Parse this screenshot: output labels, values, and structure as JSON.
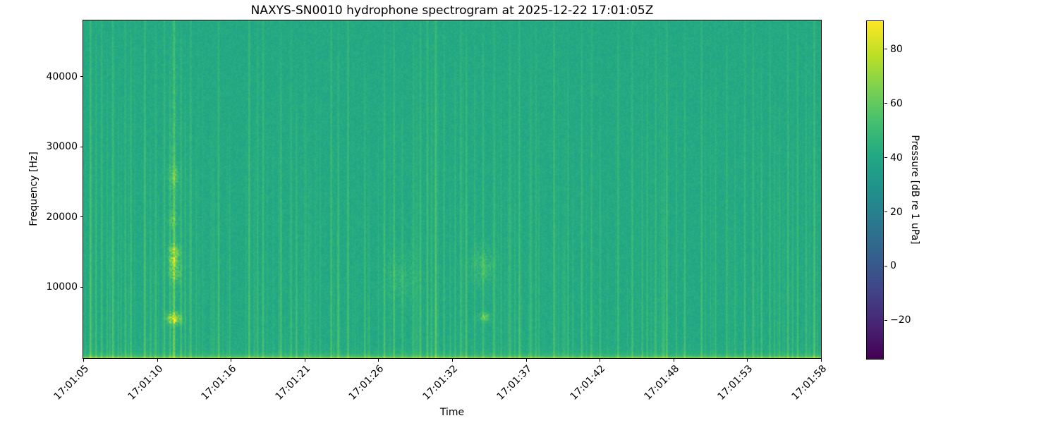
{
  "chart_data": {
    "type": "heatmap",
    "subtype": "spectrogram",
    "title": "NAXYS-SN0010 hydrophone spectrogram at 2025-12-22 17:01:05Z",
    "xlabel": "Time",
    "ylabel": "Frequency [Hz]",
    "x_tick_labels": [
      "17:01:05",
      "17:01:10",
      "17:01:16",
      "17:01:21",
      "17:01:26",
      "17:01:32",
      "17:01:37",
      "17:01:42",
      "17:01:48",
      "17:01:53",
      "17:01:58"
    ],
    "y_ticks_hz": [
      10000,
      20000,
      30000,
      40000
    ],
    "freq_range_hz": [
      0,
      48000
    ],
    "time_span_s": 53,
    "start_time": "17:01:05Z",
    "colormap": "viridis",
    "grid": false,
    "colorbar": {
      "label": "Pressure [dB re 1 uPa]",
      "vmin": -34,
      "vmax": 90.4,
      "ticks": [
        {
          "v": 80,
          "label": "80"
        },
        {
          "v": 60,
          "label": "60"
        },
        {
          "v": 40,
          "label": "40"
        },
        {
          "v": 20,
          "label": "20"
        },
        {
          "v": 0,
          "label": "0"
        },
        {
          "v": -20,
          "label": "−20"
        }
      ]
    },
    "background_db": 41,
    "noise_db": 2.6,
    "bottom_band": {
      "desc": "bright low-frequency noise band below ~1 kHz",
      "peak_boost_db": 26
    },
    "transients": [
      [
        0.5,
        0.85,
        1.0
      ],
      [
        0.9,
        0.5,
        0.9
      ],
      [
        1.3,
        0.6,
        1.0
      ],
      [
        1.7,
        0.4,
        0.8
      ],
      [
        2.1,
        0.7,
        1.0
      ],
      [
        2.5,
        0.4,
        0.7
      ],
      [
        3.0,
        0.5,
        1.0
      ],
      [
        3.4,
        0.6,
        0.9
      ],
      [
        4.4,
        0.8,
        1.0
      ],
      [
        4.8,
        0.4,
        0.6
      ],
      [
        5.2,
        0.5,
        0.9
      ],
      [
        5.8,
        0.6,
        1.0
      ],
      [
        6.2,
        0.5,
        0.8
      ],
      [
        6.5,
        1.0,
        1.0
      ],
      [
        7.0,
        0.6,
        0.9
      ],
      [
        7.3,
        0.45,
        0.7
      ],
      [
        7.7,
        0.5,
        1.0
      ],
      [
        8.1,
        0.35,
        0.6
      ],
      [
        9.7,
        0.6,
        1.0
      ],
      [
        10.5,
        0.3,
        0.5
      ],
      [
        11.9,
        0.75,
        1.0
      ],
      [
        12.5,
        0.5,
        0.9
      ],
      [
        12.9,
        0.6,
        1.0
      ],
      [
        14.2,
        0.5,
        0.8
      ],
      [
        14.9,
        0.45,
        0.9
      ],
      [
        15.3,
        0.5,
        0.7
      ],
      [
        16.2,
        0.35,
        0.5
      ],
      [
        17.8,
        0.6,
        1.0
      ],
      [
        18.3,
        0.55,
        0.9
      ],
      [
        19.0,
        0.7,
        1.0
      ],
      [
        20.2,
        0.45,
        0.8
      ],
      [
        21.6,
        0.5,
        0.9
      ],
      [
        22.3,
        0.6,
        1.0
      ],
      [
        22.9,
        0.45,
        0.7
      ],
      [
        23.7,
        0.5,
        0.9
      ],
      [
        24.2,
        0.6,
        1.0
      ],
      [
        24.7,
        0.7,
        1.0
      ],
      [
        25.0,
        0.5,
        0.8
      ],
      [
        25.3,
        0.9,
        1.0
      ],
      [
        25.9,
        0.5,
        0.9
      ],
      [
        26.7,
        0.45,
        0.8
      ],
      [
        27.1,
        0.6,
        1.0
      ],
      [
        27.5,
        0.5,
        0.9
      ],
      [
        28.1,
        0.45,
        0.8
      ],
      [
        28.7,
        0.6,
        0.9
      ],
      [
        29.5,
        0.5,
        1.0
      ],
      [
        30.0,
        0.4,
        0.7
      ],
      [
        30.6,
        0.5,
        0.9
      ],
      [
        31.3,
        0.6,
        1.0
      ],
      [
        32.1,
        0.5,
        0.8
      ],
      [
        32.5,
        0.45,
        0.9
      ],
      [
        33.8,
        0.7,
        1.0
      ],
      [
        34.8,
        0.5,
        0.8
      ],
      [
        35.8,
        0.45,
        0.9
      ],
      [
        36.5,
        0.5,
        1.0
      ],
      [
        37.1,
        0.4,
        0.7
      ],
      [
        38.4,
        0.6,
        0.9
      ],
      [
        39.4,
        0.5,
        1.0
      ],
      [
        40.5,
        0.45,
        0.8
      ],
      [
        41.1,
        0.5,
        0.9
      ],
      [
        41.9,
        0.6,
        1.0
      ],
      [
        42.6,
        0.4,
        0.7
      ],
      [
        43.2,
        0.5,
        0.9
      ],
      [
        44.4,
        0.6,
        1.0
      ],
      [
        45.4,
        0.45,
        0.8
      ],
      [
        46.2,
        0.5,
        0.9
      ],
      [
        46.8,
        0.4,
        0.7
      ],
      [
        47.5,
        0.5,
        1.0
      ],
      [
        48.1,
        0.6,
        0.9
      ],
      [
        48.7,
        0.45,
        0.8
      ],
      [
        49.3,
        0.5,
        0.9
      ],
      [
        50.0,
        0.4,
        0.7
      ],
      [
        50.6,
        0.5,
        1.0
      ],
      [
        51.3,
        0.6,
        0.9
      ],
      [
        51.9,
        0.5,
        0.8
      ],
      [
        52.5,
        0.75,
        1.0
      ]
    ],
    "minor_transients": {
      "count": 260,
      "min_strength": 0.04,
      "max_strength": 0.28
    },
    "events": [
      {
        "t": 6.5,
        "f": 14500,
        "st": 0.28,
        "sf": 1100,
        "amp": 22
      },
      {
        "t": 6.6,
        "f": 12000,
        "st": 0.3,
        "sf": 900,
        "amp": 13
      },
      {
        "t": 6.5,
        "f": 5600,
        "st": 0.33,
        "sf": 550,
        "amp": 30
      },
      {
        "t": 6.45,
        "f": 19500,
        "st": 0.22,
        "sf": 900,
        "amp": 8
      },
      {
        "t": 6.5,
        "f": 26000,
        "st": 0.25,
        "sf": 1300,
        "amp": 10
      },
      {
        "t": 6.5,
        "f": 24000,
        "st": 0.18,
        "sf": 22000,
        "amp": 3.5
      },
      {
        "t": 28.7,
        "f": 13000,
        "st": 0.55,
        "sf": 1700,
        "amp": 8
      },
      {
        "t": 28.8,
        "f": 5800,
        "st": 0.28,
        "sf": 450,
        "amp": 16
      },
      {
        "t": 22.8,
        "f": 11500,
        "st": 0.8,
        "sf": 2500,
        "amp": 4
      }
    ],
    "colors": {
      "background_field": "#22aa84",
      "transient_streak": "#a4d63c",
      "colorbar_top": "#fde725",
      "colorbar_bottom": "#440154",
      "text": "#000000"
    }
  }
}
